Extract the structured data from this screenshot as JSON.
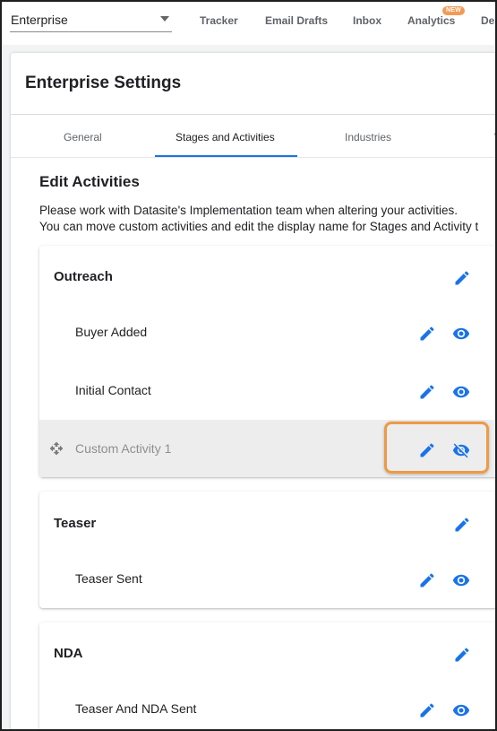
{
  "topbar": {
    "workspace_select": "Enterprise",
    "nav": [
      "Tracker",
      "Email Drafts",
      "Inbox",
      "Analytics",
      "Dea"
    ],
    "analytics_badge": "NEW"
  },
  "page": {
    "title": "Enterprise Settings",
    "tabs": [
      "General",
      "Stages and Activities",
      "Industries"
    ],
    "active_tab": "Stages and Activities"
  },
  "section": {
    "title": "Edit Activities",
    "description_lines": [
      "Please work with Datasite's Implementation team when altering your activities.",
      "You can move custom activities and edit the display name for Stages and Activity t"
    ]
  },
  "stages": [
    {
      "name": "Outreach",
      "activities": [
        {
          "label": "Buyer Added",
          "visible": true
        },
        {
          "label": "Initial Contact",
          "visible": true
        },
        {
          "label": "Custom Activity 1",
          "visible": false,
          "custom": true
        }
      ]
    },
    {
      "name": "Teaser",
      "activities": [
        {
          "label": "Teaser Sent",
          "visible": true
        }
      ]
    },
    {
      "name": "NDA",
      "activities": [
        {
          "label": "Teaser And NDA Sent",
          "visible": true
        }
      ]
    }
  ],
  "colors": {
    "accent": "#1a73e8",
    "highlight_border": "#ee9a45",
    "badge": "#f29b56",
    "row_highlight": "#ededed"
  },
  "icons": {
    "edit": "pencil-icon",
    "visible": "eye-icon",
    "hidden": "eye-off-icon",
    "move": "move-icon",
    "dropdown": "caret-down-icon"
  }
}
